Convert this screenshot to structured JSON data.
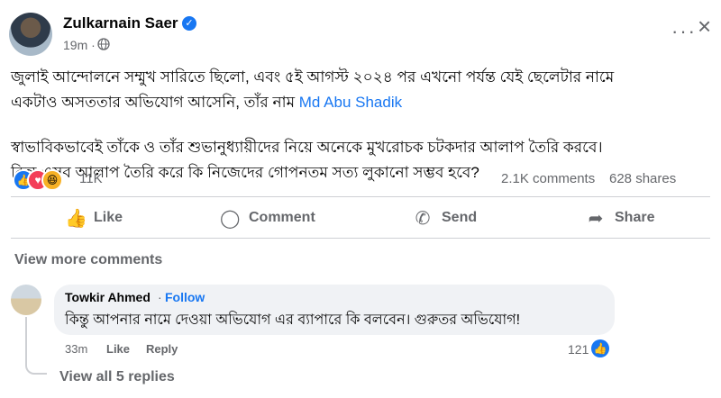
{
  "post": {
    "author": "Zulkarnain Saer",
    "time": "19m",
    "dot": "·",
    "text_line1": "জুলাই আন্দোলনে সম্মুখ সারিতে ছিলো, এবং ৫ই আগস্ট ২০২৪ পর এখনো পর্যন্ত যেই ছেলেটার নামে",
    "text_line2_prefix": "একটাও অসততার অভিযোগ আসেনি, তাঁর নাম ",
    "text_line2_link": "Md Abu Shadik",
    "text_para2_line1": "স্বাভাবিকভাবেই তাঁকে ও তাঁর শুভানুধ্যায়ীদের নিয়ে অনেকে মুখরোচক চটকদার আলাপ তৈরি করবে।",
    "text_para2_line2": "কিন্তু এসব আলাপ তৈরি করে কি নিজেদের গোপনতম সত্য লুকানো সম্ভব হবে?",
    "reactions_count": "11K",
    "comments_count": "2.1K comments",
    "shares_count": "628 shares"
  },
  "actions": {
    "like": "Like",
    "comment": "Comment",
    "send": "Send",
    "share": "Share"
  },
  "view_more_comments": "View more comments",
  "comment": {
    "author": "Towkir Ahmed",
    "dot": "·",
    "follow": "Follow",
    "text": "কিন্তু আপনার নামে দেওয়া অভিযোগ এর ব্যাপারে কি বলবেন। গুরুতর অভিযোগ!",
    "time": "33m",
    "like": "Like",
    "reply": "Reply",
    "likes_count": "121",
    "view_replies": "View all 5 replies"
  },
  "icons": {
    "verified": "verified-badge-icon",
    "globe": "globe-icon",
    "more": "more-options-icon",
    "close": "close-icon"
  },
  "colors": {
    "accent": "#1877f2",
    "muted": "#65676b",
    "bubble": "#f0f2f5"
  }
}
